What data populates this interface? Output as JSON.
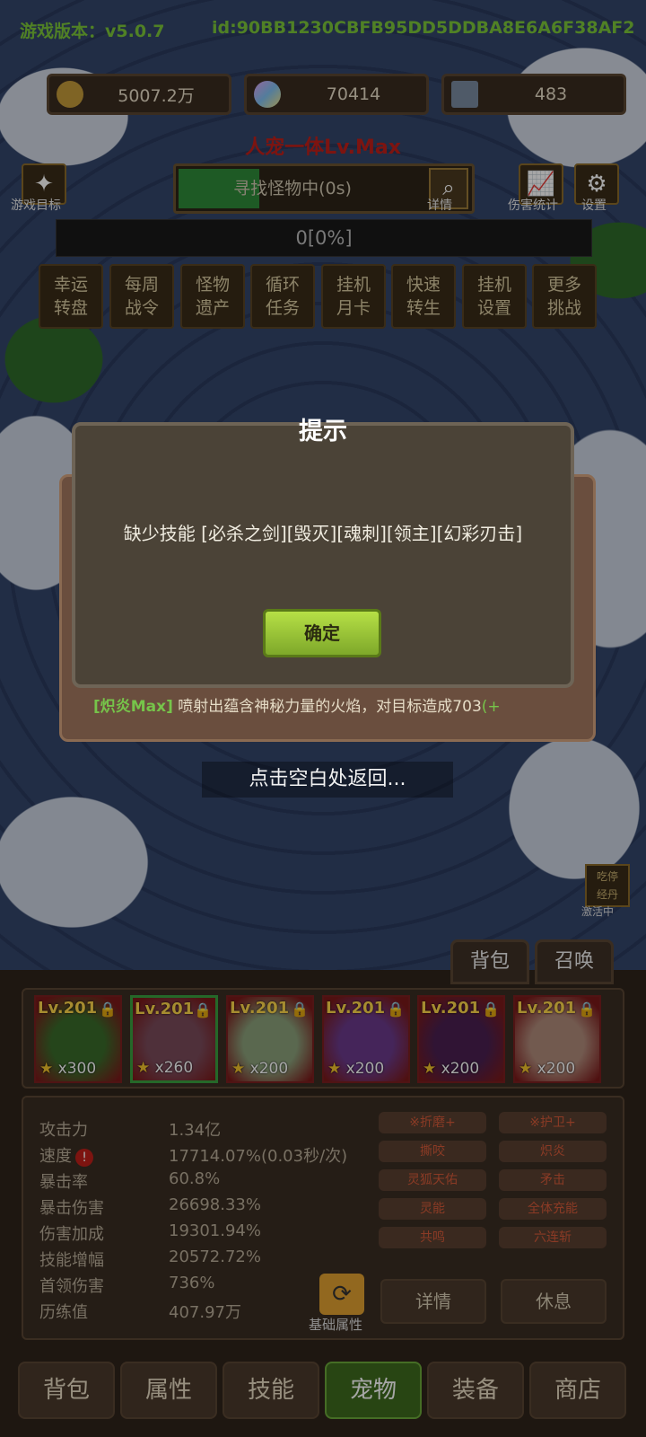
{
  "header": {
    "version_text": "游戏版本：v5.0.7",
    "id_text": "id:90BB1230CBFB95DD5DDBA8E6A6F38AF2"
  },
  "resources": [
    {
      "icon": "coin-icon",
      "value": "5007.2万"
    },
    {
      "icon": "crystal-icon",
      "value": "70414"
    },
    {
      "icon": "card-icon",
      "value": "483"
    }
  ],
  "slogan": "人宠一体Lv.Max",
  "left_button": {
    "label": "游戏目标"
  },
  "search": {
    "status": "寻找怪物中(0s)",
    "detail_label": "详情"
  },
  "right_buttons": [
    {
      "label": "伤害统计"
    },
    {
      "label": "设置"
    }
  ],
  "progress_text": "0[0%]",
  "menu": [
    {
      "line1": "幸运",
      "line2": "转盘"
    },
    {
      "line1": "每周",
      "line2": "战令"
    },
    {
      "line1": "怪物",
      "line2": "遗产"
    },
    {
      "line1": "循环",
      "line2": "任务"
    },
    {
      "line1": "挂机",
      "line2": "月卡"
    },
    {
      "line1": "快速",
      "line2": "转生"
    },
    {
      "line1": "挂机",
      "line2": "设置"
    },
    {
      "line1": "更多",
      "line2": "挑战"
    }
  ],
  "dialog": {
    "title": "提示",
    "message": "缺少技能 [必杀之剑][毁灭][魂刺][领主][幻彩刃击]",
    "ok_label": "确定"
  },
  "skill_desc": {
    "tag": "[炽炎Max]",
    "text": " 喷射出蕴含神秘力量的火焰，对目标造成703",
    "suffix": "(+"
  },
  "return_hint": "点击空白处返回...",
  "side_badge": {
    "line1": "吃停",
    "line2": "经丹",
    "label": "激活中"
  },
  "bag_tabs": [
    "背包",
    "召唤"
  ],
  "pets": [
    {
      "level": "Lv.201",
      "count": "x300",
      "color": "#3a6a2a"
    },
    {
      "level": "Lv.201",
      "count": "x260",
      "color": "#7a4a5a"
    },
    {
      "level": "Lv.201",
      "count": "x200",
      "color": "#8aa07a"
    },
    {
      "level": "Lv.201",
      "count": "x200",
      "color": "#6a3a8a"
    },
    {
      "level": "Lv.201",
      "count": "x200",
      "color": "#4a2050"
    },
    {
      "level": "Lv.201",
      "count": "x200",
      "color": "#b08a7a"
    }
  ],
  "stats": [
    {
      "label": "攻击力",
      "value": "1.34亿"
    },
    {
      "label": "速度",
      "value": "17714.07%(0.03秒/次)"
    },
    {
      "label": "暴击率",
      "value": "60.8%"
    },
    {
      "label": "暴击伤害",
      "value": "26698.33%"
    },
    {
      "label": "伤害加成",
      "value": "19301.94%"
    },
    {
      "label": "技能增幅",
      "value": "20572.72%"
    },
    {
      "label": "首领伤害",
      "value": "736%"
    },
    {
      "label": "历练值",
      "value": "407.97万"
    }
  ],
  "pet_skills": [
    "※折磨+",
    "※护卫+",
    "撕咬",
    "炽炎",
    "灵狐天佑",
    "矛击",
    "灵能",
    "全体充能",
    "共鸣",
    "六连斩"
  ],
  "basic_attr_label": "基础属性",
  "actions": [
    "详情",
    "休息"
  ],
  "nav": [
    "背包",
    "属性",
    "技能",
    "宠物",
    "装备",
    "商店"
  ]
}
